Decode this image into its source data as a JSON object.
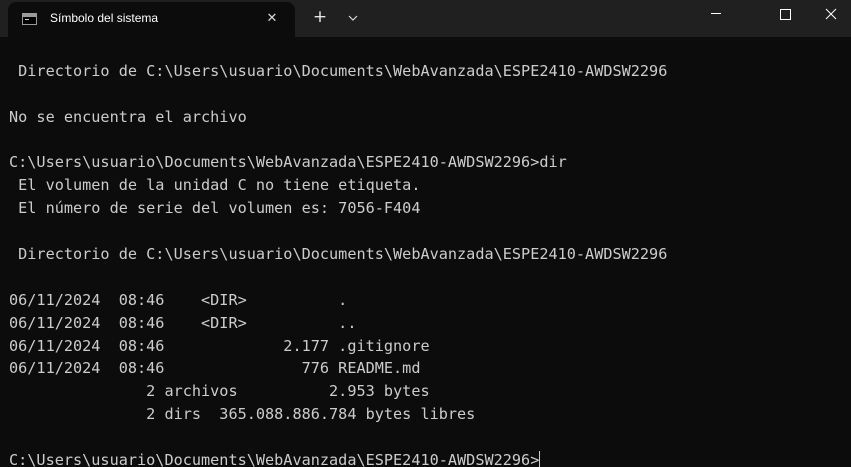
{
  "tab": {
    "title": "Símbolo del sistema",
    "icon": "console-icon",
    "close_label": "✕",
    "new_tab_label": "+",
    "dropdown_icon": "chevron-down-icon"
  },
  "window_controls": {
    "minimize_icon": "minimize-icon",
    "maximize_icon": "maximize-icon",
    "close_icon": "close-icon"
  },
  "console": {
    "lines": [
      "",
      " Directorio de C:\\Users\\usuario\\Documents\\WebAvanzada\\ESPE2410-AWDSW2296",
      "",
      "No se encuentra el archivo",
      "",
      "C:\\Users\\usuario\\Documents\\WebAvanzada\\ESPE2410-AWDSW2296>dir",
      " El volumen de la unidad C no tiene etiqueta.",
      " El número de serie del volumen es: 7056-F404",
      "",
      " Directorio de C:\\Users\\usuario\\Documents\\WebAvanzada\\ESPE2410-AWDSW2296",
      "",
      "06/11/2024  08:46    <DIR>          .",
      "06/11/2024  08:46    <DIR>          ..",
      "06/11/2024  08:46             2.177 .gitignore",
      "06/11/2024  08:46               776 README.md",
      "               2 archivos          2.953 bytes",
      "               2 dirs  365.088.886.784 bytes libres",
      ""
    ],
    "prompt": "C:\\Users\\usuario\\Documents\\WebAvanzada\\ESPE2410-AWDSW2296>"
  }
}
